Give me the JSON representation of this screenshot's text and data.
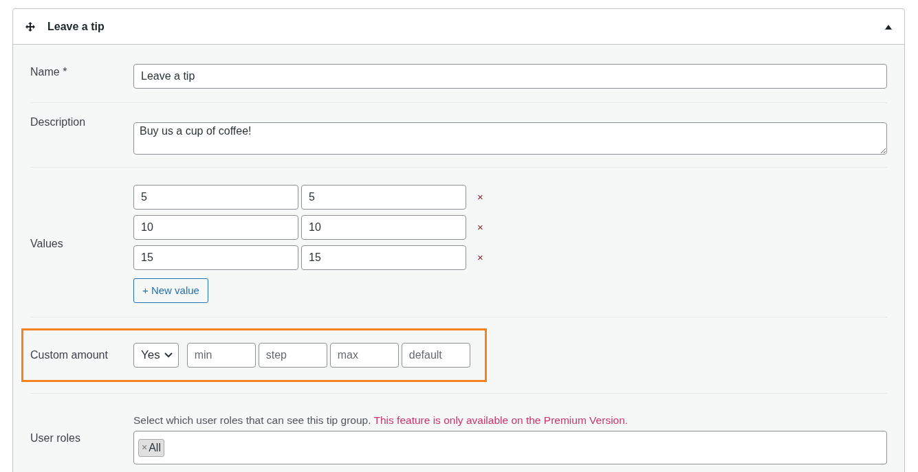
{
  "panel": {
    "title": "Leave a tip",
    "expanded": true
  },
  "name": {
    "label": "Name *",
    "value": "Leave a tip"
  },
  "description": {
    "label": "Description",
    "value": "Buy us a cup of coffee!"
  },
  "values": {
    "label": "Values",
    "rows": [
      {
        "amount": "5",
        "label": "5",
        "remove": "×"
      },
      {
        "amount": "10",
        "label": "10",
        "remove": "×"
      },
      {
        "amount": "15",
        "label": "15",
        "remove": "×"
      }
    ],
    "add_button": "+ New value"
  },
  "custom_amount": {
    "label": "Custom amount",
    "highlighted": true,
    "select": "Yes",
    "fields": [
      {
        "placeholder": "min"
      },
      {
        "placeholder": "step"
      },
      {
        "placeholder": "max"
      },
      {
        "placeholder": "default"
      }
    ]
  },
  "user_roles": {
    "label": "User roles",
    "help": "Select which user roles that can see this tip group.",
    "notice": "This feature is only available on the Premium Version.",
    "tags": [
      {
        "remove": "×",
        "label": "All"
      }
    ]
  }
}
